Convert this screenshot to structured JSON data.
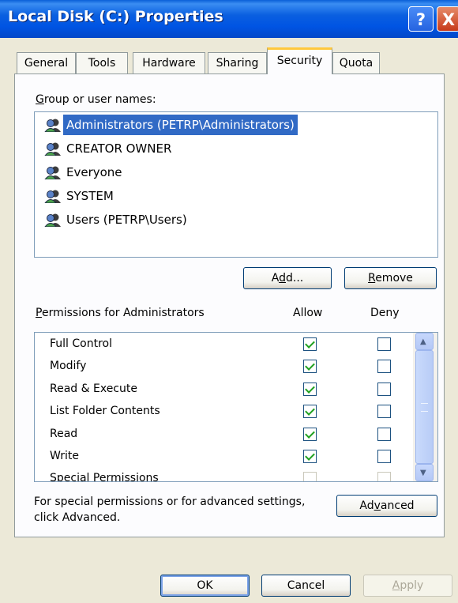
{
  "window": {
    "title": "Local Disk (C:) Properties",
    "help_label": "?",
    "close_label": "X"
  },
  "tabs": [
    {
      "label": "General"
    },
    {
      "label": "Tools"
    },
    {
      "label": "Hardware"
    },
    {
      "label": "Sharing"
    },
    {
      "label": "Security",
      "active": true
    },
    {
      "label": "Quota"
    }
  ],
  "groups": {
    "label_mnemonic": "G",
    "label_rest": "roup or user names:",
    "items": [
      {
        "name": "Administrators (PETRP\\Administrators)",
        "selected": true
      },
      {
        "name": "CREATOR OWNER"
      },
      {
        "name": "Everyone"
      },
      {
        "name": "SYSTEM"
      },
      {
        "name": "Users (PETRP\\Users)"
      }
    ],
    "icon": "users-group-icon"
  },
  "buttons": {
    "add": {
      "pre": "A",
      "mnemonic": "d",
      "post": "d..."
    },
    "remove": {
      "mnemonic": "R",
      "post": "emove"
    },
    "advanced": {
      "pre": "Ad",
      "mnemonic": "v",
      "post": "anced"
    },
    "ok": "OK",
    "cancel": "Cancel",
    "apply": {
      "mnemonic": "A",
      "post": "pply"
    }
  },
  "permissions": {
    "label_mnemonic": "P",
    "label_rest": "ermissions for Administrators",
    "allow_header": "Allow",
    "deny_header": "Deny",
    "rows": [
      {
        "name": "Full Control",
        "allow": true,
        "deny": false
      },
      {
        "name": "Modify",
        "allow": true,
        "deny": false
      },
      {
        "name": "Read & Execute",
        "allow": true,
        "deny": false
      },
      {
        "name": "List Folder Contents",
        "allow": true,
        "deny": false
      },
      {
        "name": "Read",
        "allow": true,
        "deny": false
      },
      {
        "name": "Write",
        "allow": true,
        "deny": false
      },
      {
        "name": "Special Permissions",
        "allow": false,
        "deny": false,
        "disabled": true
      }
    ]
  },
  "advanced_text": {
    "line1": "For special permissions or for advanced settings,",
    "line2": "click Advanced."
  },
  "colors": {
    "titlebar": "#0054E3",
    "selection": "#316AC5",
    "dialog_bg": "#ECE9D8",
    "tab_highlight": "#FFC83C"
  }
}
